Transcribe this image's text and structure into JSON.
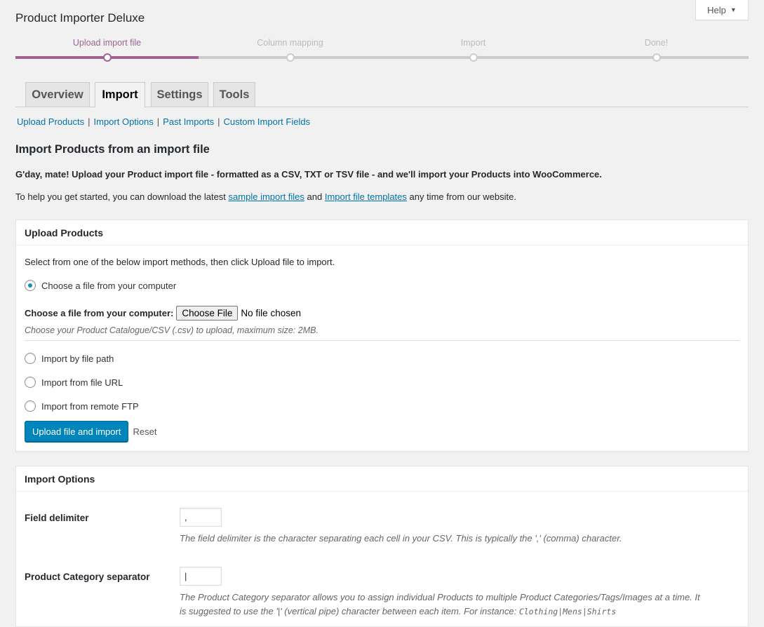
{
  "help": {
    "label": "Help",
    "arrow": "▼"
  },
  "page": {
    "title": "Product Importer Deluxe"
  },
  "steps": [
    {
      "label": "Upload import file",
      "active": true
    },
    {
      "label": "Column mapping",
      "active": false
    },
    {
      "label": "Import",
      "active": false
    },
    {
      "label": "Done!",
      "active": false
    }
  ],
  "tabs": [
    {
      "label": "Overview",
      "active": false
    },
    {
      "label": "Import",
      "active": true
    },
    {
      "label": "Settings",
      "active": false
    },
    {
      "label": "Tools",
      "active": false
    }
  ],
  "sublinks": [
    "Upload Products",
    "Import Options",
    "Past Imports",
    "Custom Import Fields"
  ],
  "sublink_separator": "|",
  "section_title": "Import Products from an import file",
  "intro": {
    "line1": "G'day, mate! Upload your Product import file - formatted as a CSV, TXT or TSV file - and we'll import your Products into WooCommerce.",
    "line2_prefix": "To help you get started, you can download the latest ",
    "link1": "sample import files",
    "line2_mid": " and ",
    "link2": "Import file templates",
    "line2_suffix": " any time from our website."
  },
  "upload": {
    "title": "Upload Products",
    "instruction": "Select from one of the below import methods, then click Upload file to import.",
    "method_computer": "Choose a file from your computer",
    "file_label": "Choose a file from your computer:",
    "choose_file_button": "Choose File",
    "no_file_text": "No file chosen",
    "file_hint": "Choose your Product Catalogue/CSV (.csv) to upload, maximum size: 2MB.",
    "method_path": "Import by file path",
    "method_url": "Import from file URL",
    "method_ftp": "Import from remote FTP",
    "submit_button": "Upload file and import",
    "reset_link": "Reset"
  },
  "options": {
    "title": "Import Options",
    "delimiter_label": "Field delimiter",
    "delimiter_value": ",",
    "delimiter_desc": "The field delimiter is the character separating each cell in your CSV. This is typically the ',' (comma) character.",
    "category_label": "Product Category separator",
    "category_value": "|",
    "category_desc_1": "The Product Category separator allows you to assign individual Products to multiple Product Categories/Tags/Images at a time. It",
    "category_desc_2": "is suggested to use the '|' (vertical pipe) character between each item. For instance: ",
    "category_example": "Clothing|Mens|Shirts"
  },
  "colors": {
    "accent": "#9e6390",
    "link": "#0073aa",
    "primary_button": "#0085ba"
  }
}
